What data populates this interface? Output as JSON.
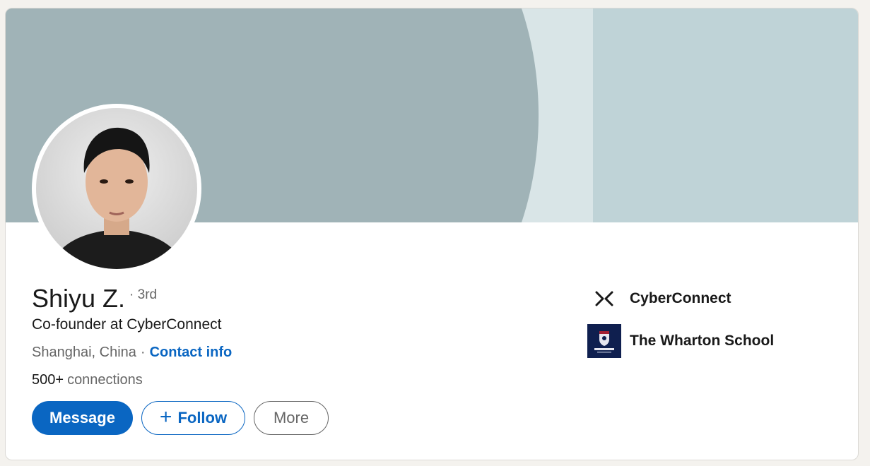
{
  "profile": {
    "name": "Shiyu Z.",
    "degree": "· 3rd",
    "headline": "Co-founder at CyberConnect",
    "location": "Shanghai, China",
    "separator": "·",
    "contact_label": "Contact info",
    "connections_count": "500+",
    "connections_label": "connections"
  },
  "actions": {
    "message_label": "Message",
    "follow_icon": "+",
    "follow_label": "Follow",
    "more_label": "More"
  },
  "affiliations": [
    {
      "name": "CyberConnect",
      "icon": "cyberconnect-logo"
    },
    {
      "name": "The Wharton School",
      "icon": "wharton-logo"
    }
  ],
  "colors": {
    "primary": "#0a66c2",
    "page_background": "#f4f2ee",
    "banner_dark": "#a0b3b7",
    "banner_light": "#bfd3d7"
  }
}
